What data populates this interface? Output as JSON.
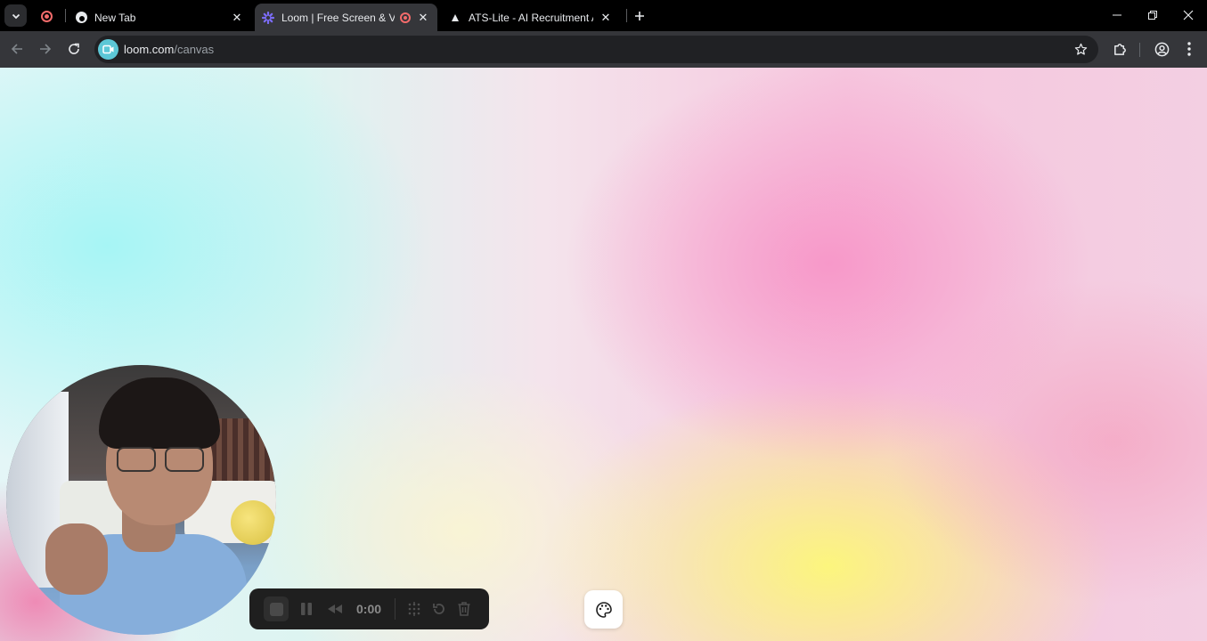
{
  "tabs": [
    {
      "title": "New Tab",
      "favicon": "chrome-icon",
      "active": false
    },
    {
      "title": "Loom | Free Screen & Video Recording",
      "favicon": "loom-icon",
      "active": true,
      "recording": true
    },
    {
      "title": "ATS-Lite - AI Recruitment Assistant",
      "favicon": "vercel-triangle-icon",
      "active": false
    }
  ],
  "address_bar": {
    "domain": "loom.com",
    "path": "/canvas"
  },
  "recorder": {
    "timer": "0:00"
  },
  "colors": {
    "recording_red": "#f36b6b",
    "chrome_dark": "#35363a"
  }
}
